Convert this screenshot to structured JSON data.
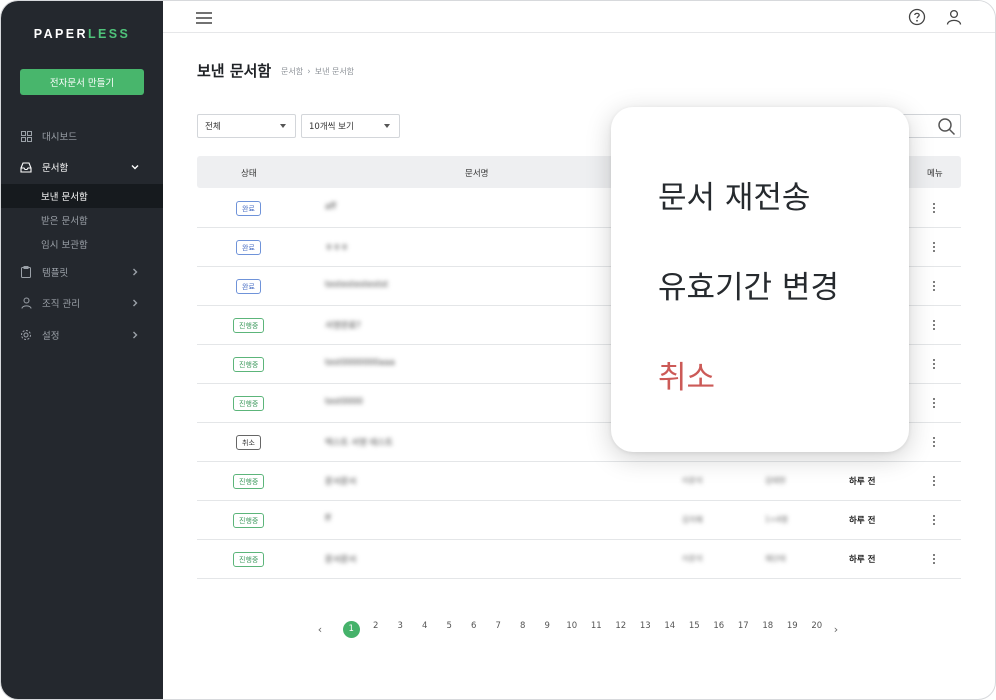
{
  "colors": {
    "sidebar_bg": "#24282e",
    "brand_green": "#48b66c",
    "accent_blue": "#4a6fc4",
    "danger_red": "#cc5a57"
  },
  "sidebar": {
    "logo_prefix": "PAPER",
    "logo_suffix": "LESS",
    "create_button": "전자문서 만들기",
    "items": [
      {
        "label": "대시보드",
        "icon": "dashboard-icon"
      },
      {
        "label": "문서함",
        "icon": "inbox-icon"
      },
      {
        "label": "템플릿",
        "icon": "clipboard-icon"
      },
      {
        "label": "조직 관리",
        "icon": "person-icon"
      },
      {
        "label": "설정",
        "icon": "gear-icon"
      }
    ],
    "sub_items": [
      "보낸 문서함",
      "받은 문서함",
      "임시 보관함"
    ]
  },
  "topbar": {
    "menu_icon": "hamburger-icon",
    "help_icon": "help-icon",
    "user_icon": "user-icon"
  },
  "page": {
    "title": "보낸 문서함",
    "breadcrumb": [
      "문서함",
      "보낸 문서함"
    ]
  },
  "filters": {
    "status_select": "전체",
    "page_size_select": "10개씩 보기"
  },
  "table": {
    "headers": {
      "status": "상태",
      "name": "문서명",
      "menu": "메뉴"
    },
    "rows": [
      {
        "status": "완료",
        "kind": "done",
        "name": "aff",
        "c": "",
        "d": "",
        "time": ""
      },
      {
        "status": "완료",
        "kind": "done",
        "name": "ㅎㅎㅎ",
        "c": "",
        "d": "",
        "time": ""
      },
      {
        "status": "완료",
        "kind": "done",
        "name": "testestestestst",
        "c": "",
        "d": "",
        "time": ""
      },
      {
        "status": "진행중",
        "kind": "prog",
        "name": "서명완료?",
        "c": "",
        "d": "",
        "time": ""
      },
      {
        "status": "진행중",
        "kind": "prog",
        "name": "test0000000aaa",
        "c": "",
        "d": "",
        "time": ""
      },
      {
        "status": "진행중",
        "kind": "prog",
        "name": "test0000",
        "c": "",
        "d": "",
        "time": ""
      },
      {
        "status": "취소",
        "kind": "cancel",
        "name": "텍스트 서명 테스트",
        "c": "",
        "d": "",
        "time": ""
      },
      {
        "status": "진행중",
        "kind": "prog",
        "name": "문서문서",
        "c": "이문석",
        "d": "김태현",
        "time": "하루 전"
      },
      {
        "status": "진행중",
        "kind": "prog",
        "name": "ff",
        "c": "김지혜",
        "d": "1+4명",
        "time": "하루 전"
      },
      {
        "status": "진행중",
        "kind": "prog",
        "name": "문서문서",
        "c": "이문석",
        "d": "제단테",
        "time": "하루 전"
      }
    ]
  },
  "pagination": {
    "prev": "‹",
    "next": "›",
    "pages": [
      "1",
      "2",
      "3",
      "4",
      "5",
      "6",
      "7",
      "8",
      "9",
      "10",
      "11",
      "12",
      "13",
      "14",
      "15",
      "16",
      "17",
      "18",
      "19",
      "20"
    ],
    "current": "1"
  },
  "popup_menu": {
    "items": [
      "문서 재전송",
      "유효기간 변경",
      "취소"
    ]
  }
}
